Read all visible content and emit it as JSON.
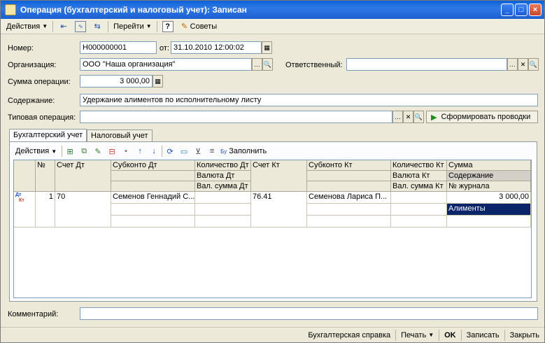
{
  "window": {
    "title": "Операция (бухгалтерский и налоговый учет): Записан"
  },
  "toolbar": {
    "actions_label": "Действия",
    "goto_label": "Перейти",
    "help_label": "?",
    "tips_label": "Советы"
  },
  "form": {
    "number_label": "Номер:",
    "number_value": "Н000000001",
    "date_label": "от:",
    "date_value": "31.10.2010 12:00:02",
    "org_label": "Организация:",
    "org_value": "ООО \"Наша организация\"",
    "resp_label": "Ответственный:",
    "resp_value": "",
    "sum_label": "Сумма операции:",
    "sum_value": "3 000,00",
    "content_label": "Содержание:",
    "content_value": "Удержание алиментов по исполнительному листу",
    "typical_label": "Типовая операция:",
    "typical_value": "",
    "generate_label": "Сформировать проводки",
    "comment_label": "Комментарий:",
    "comment_value": ""
  },
  "tabs": [
    {
      "label": "Бухгалтерский учет"
    },
    {
      "label": "Налоговый учет"
    }
  ],
  "grid_toolbar": {
    "actions_label": "Действия",
    "fill_label": "Заполнить"
  },
  "grid": {
    "headers": {
      "num": "№",
      "acc_dt": "Счет Дт",
      "sub_dt": "Субконто Дт",
      "qty_dt": "Количество Дт",
      "cur_dt": "Валюта Дт",
      "cur_sum_dt": "Вал. сумма Дт",
      "acc_kt": "Счет Кт",
      "sub_kt": "Субконто Кт",
      "qty_kt": "Количество Кт",
      "cur_kt": "Валюта Кт",
      "cur_sum_kt": "Вал. сумма Кт",
      "sum": "Сумма",
      "content": "Содержание",
      "journal": "№ журнала"
    },
    "row": {
      "icon_top": "Дт",
      "icon_bottom": "Кт",
      "num": "1",
      "acc_dt": "70",
      "sub_dt": "Семенов Геннадий С...",
      "acc_kt": "76.41",
      "sub_kt": "Семенова Лариса П...",
      "sum": "3 000,00",
      "content": "Алименты"
    }
  },
  "bottom": {
    "report_label": "Бухгалтерская справка",
    "print_label": "Печать",
    "ok_label": "OK",
    "save_label": "Записать",
    "close_label": "Закрыть"
  }
}
